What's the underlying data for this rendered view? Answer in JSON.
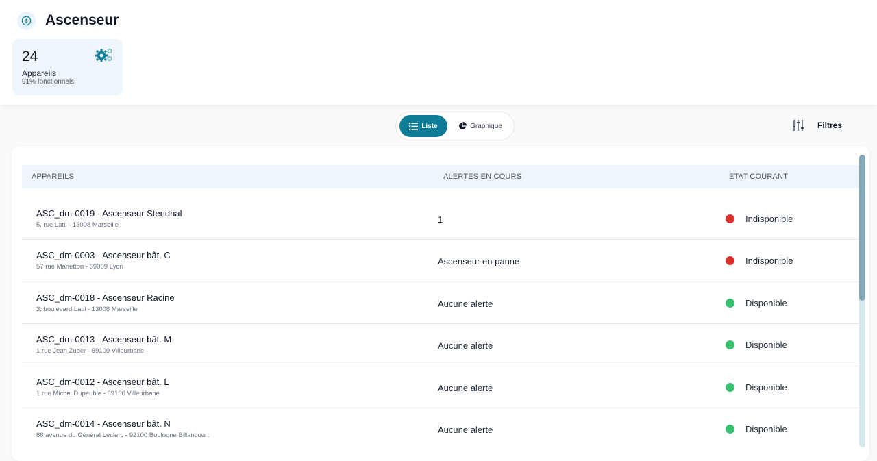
{
  "header": {
    "title": "Ascenseur",
    "icon": "elevator-icon"
  },
  "stat_card": {
    "count": "24",
    "label": "Appareils",
    "sub": "91% fonctionnels",
    "icon": "gears-icon"
  },
  "view_toggle": {
    "list_label": "Liste",
    "chart_label": "Graphique",
    "active": "Liste"
  },
  "filters": {
    "label": "Filtres",
    "icon": "sliders-icon"
  },
  "colors": {
    "accent": "#0f7d96",
    "unavailable": "#d9302b",
    "available": "#37bf6e"
  },
  "table": {
    "headers": [
      "APPAREILS",
      "ALERTES EN COURS",
      "ETAT COURANT"
    ],
    "rows": [
      {
        "name": "ASC_dm-0019 - Ascenseur Stendhal",
        "address": "5, rue Latil - 13008 Marseille",
        "alert": "1",
        "state": "Indisponible",
        "state_color": "#d9302b"
      },
      {
        "name": "ASC_dm-0003 - Ascenseur bât. C",
        "address": "57 rue Marietton - 69009 Lyon",
        "alert": "Ascenseur en panne",
        "state": "Indisponible",
        "state_color": "#d9302b"
      },
      {
        "name": "ASC_dm-0018 - Ascenseur Racine",
        "address": "3, boulevard Latil - 13008 Marseille",
        "alert": "Aucune alerte",
        "state": "Disponible",
        "state_color": "#37bf6e"
      },
      {
        "name": "ASC_dm-0013 - Ascenseur bât. M",
        "address": "1 rue Jean Zuber - 69100 Villeurbane",
        "alert": "Aucune alerte",
        "state": "Disponible",
        "state_color": "#37bf6e"
      },
      {
        "name": "ASC_dm-0012 - Ascenseur bât. L",
        "address": "1 rue Michel Dupeuble - 69100 Villeurbane",
        "alert": "Aucune alerte",
        "state": "Disponible",
        "state_color": "#37bf6e"
      },
      {
        "name": "ASC_dm-0014 - Ascenseur bât. N",
        "address": "88 avenue du Général Leclerc - 92100 Boulogne Billancourt",
        "alert": "Aucune alerte",
        "state": "Disponible",
        "state_color": "#37bf6e"
      }
    ]
  }
}
